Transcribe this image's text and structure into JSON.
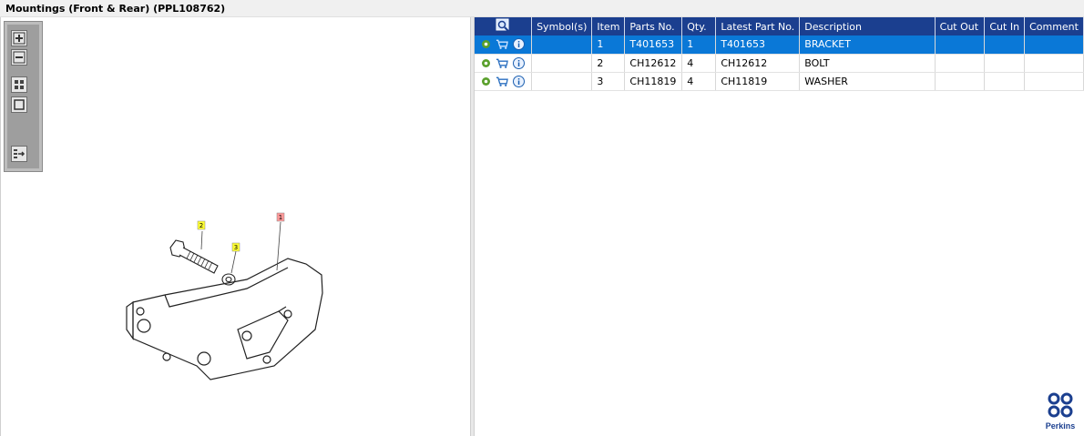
{
  "window": {
    "title": "Mountings (Front & Rear) (PPL108762)"
  },
  "viewer": {
    "toolbar": [
      {
        "name": "zoom-in-icon",
        "label": "+"
      },
      {
        "name": "zoom-out-icon",
        "label": "-"
      },
      {
        "name": "fit-grid-icon",
        "label": ""
      },
      {
        "name": "actual-size-icon",
        "label": ""
      },
      {
        "name": "toggle-list-icon",
        "label": ""
      }
    ],
    "callouts": [
      "1",
      "2",
      "3"
    ]
  },
  "table": {
    "columns": [
      "Symbol(s)",
      "Item",
      "Parts No.",
      "Qty.",
      "Latest Part No.",
      "Description",
      "Cut Out",
      "Cut In",
      "Comment"
    ],
    "rows": [
      {
        "item": "1",
        "part_no": "T401653",
        "qty": "1",
        "latest_part_no": "T401653",
        "description": "BRACKET",
        "cut_out": "",
        "cut_in": "",
        "comment": ""
      },
      {
        "item": "2",
        "part_no": "CH12612",
        "qty": "4",
        "latest_part_no": "CH12612",
        "description": "BOLT",
        "cut_out": "",
        "cut_in": "",
        "comment": ""
      },
      {
        "item": "3",
        "part_no": "CH11819",
        "qty": "4",
        "latest_part_no": "CH11819",
        "description": "WASHER",
        "cut_out": "",
        "cut_in": "",
        "comment": ""
      }
    ],
    "selected_row_index": 0
  },
  "brand": {
    "name": "Perkins",
    "color": "#1b3f8f"
  },
  "colors": {
    "header": "#1b3f8f",
    "selected": "#0a78d7",
    "callout_yellow": "#ffff33",
    "callout_red": "#ff9999"
  }
}
